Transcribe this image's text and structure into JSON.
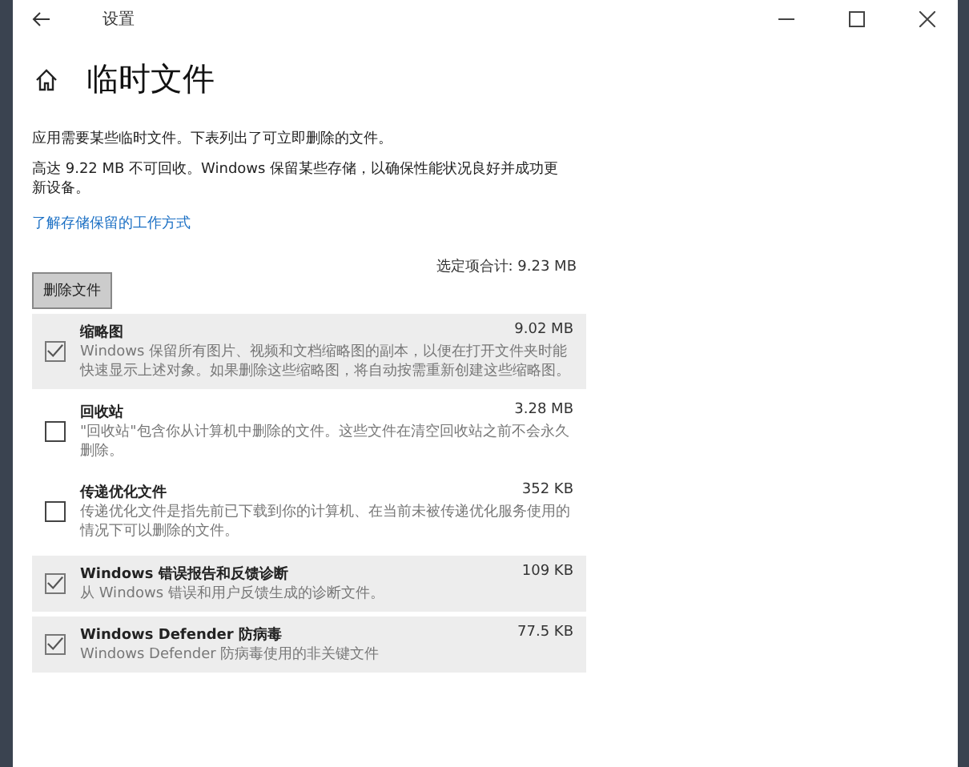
{
  "window": {
    "title": "设置"
  },
  "page": {
    "title": "临时文件"
  },
  "intro": [
    "应用需要某些临时文件。下表列出了可立即删除的文件。",
    "高达 9.22 MB 不可回收。Windows 保留某些存储，以确保性能状况良好并成功更新设备。"
  ],
  "link": "了解存储保留的工作方式",
  "delete_button": "删除文件",
  "total": "选定项合计: 9.23 MB",
  "items": [
    {
      "name": "缩略图",
      "size": "9.02 MB",
      "description": "Windows 保留所有图片、视频和文档缩略图的副本，以便在打开文件夹时能快速显示上述对象。如果删除这些缩略图，将自动按需重新创建这些缩略图。",
      "checked": true
    },
    {
      "name": "回收站",
      "size": "3.28 MB",
      "description": "\"回收站\"包含你从计算机中删除的文件。这些文件在清空回收站之前不会永久删除。",
      "checked": false
    },
    {
      "name": "传递优化文件",
      "size": "352 KB",
      "description": "传递优化文件是指先前已下载到你的计算机、在当前未被传递优化服务使用的情况下可以删除的文件。",
      "checked": false
    },
    {
      "name": "Windows 错误报告和反馈诊断",
      "size": "109 KB",
      "description": "从 Windows 错误和用户反馈生成的诊断文件。",
      "checked": true
    },
    {
      "name": "Windows Defender 防病毒",
      "size": "77.5 KB",
      "description": "Windows Defender 防病毒使用的非关键文件",
      "checked": true
    }
  ]
}
